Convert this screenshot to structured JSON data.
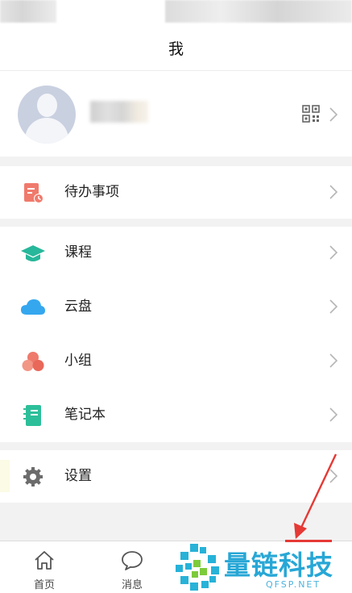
{
  "header": {
    "title": "我"
  },
  "profile": {
    "qr_icon": "qr-code-icon"
  },
  "menu": {
    "group1": [
      {
        "label": "待办事项",
        "icon": "todo-icon",
        "color": "#f07a6c"
      }
    ],
    "group2": [
      {
        "label": "课程",
        "icon": "course-icon",
        "color": "#27b79a"
      },
      {
        "label": "云盘",
        "icon": "cloud-icon",
        "color": "#35a7ef"
      },
      {
        "label": "小组",
        "icon": "group-icon",
        "color": "#ee7a6c"
      },
      {
        "label": "笔记本",
        "icon": "notebook-icon",
        "color": "#2dbf9a"
      }
    ],
    "group3": [
      {
        "label": "设置",
        "icon": "gear-icon",
        "color": "#6c6c6c"
      }
    ]
  },
  "tabbar": {
    "home": {
      "label": "首页",
      "icon": "home-icon"
    },
    "messages": {
      "label": "消息",
      "icon": "chat-bubble-icon"
    }
  },
  "watermark": {
    "text": "量链科技",
    "sub": "QFSP.NET"
  },
  "colors": {
    "accent_red": "#e53935",
    "watermark_blue": "#27a7d6"
  }
}
